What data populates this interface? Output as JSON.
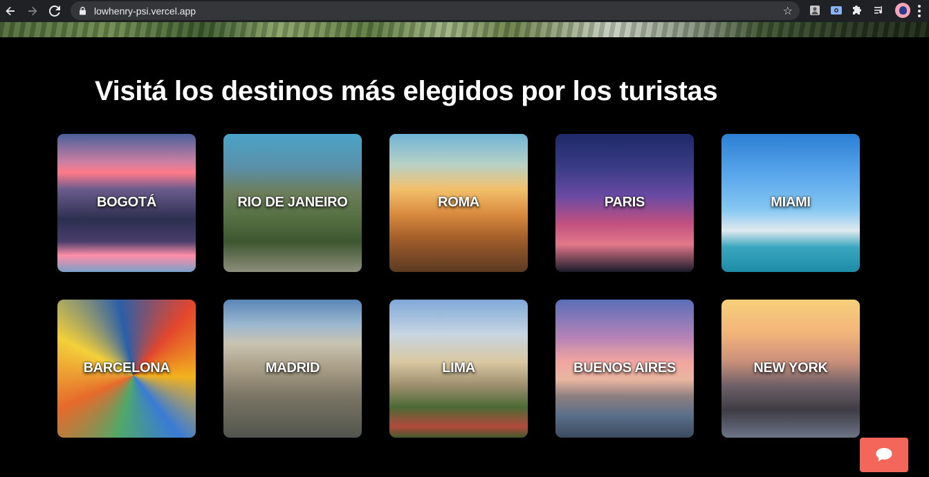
{
  "browser": {
    "url": "lowhenry-psi.vercel.app",
    "icons": [
      "back-arrow-icon",
      "forward-arrow-icon",
      "reload-icon",
      "lock-icon",
      "star-icon",
      "extension-icon",
      "puzzle-icon",
      "media-icon",
      "avatar",
      "menu-icon"
    ]
  },
  "page": {
    "title": "Visitá los destinos más elegidos por los turistas"
  },
  "destinations": [
    {
      "label": "BOGOTÁ"
    },
    {
      "label": "RIO DE JANEIRO"
    },
    {
      "label": "ROMA"
    },
    {
      "label": "PARIS"
    },
    {
      "label": "MIAMI"
    },
    {
      "label": "BARCELONA"
    },
    {
      "label": "MADRID"
    },
    {
      "label": "LIMA"
    },
    {
      "label": "BUENOS AIRES"
    },
    {
      "label": "NEW YORK"
    }
  ],
  "chat": {
    "icon": "chat-bubble-icon",
    "color": "#f4665a"
  }
}
